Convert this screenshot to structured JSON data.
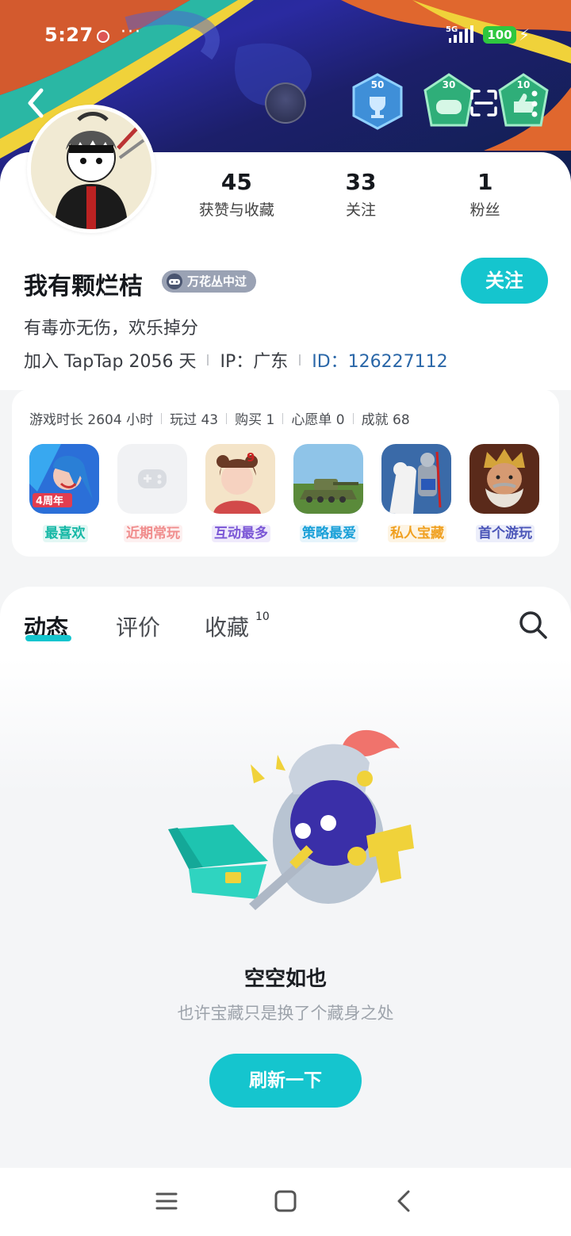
{
  "status_bar": {
    "time": "5:27",
    "more": "···",
    "network": "5G",
    "battery": "100"
  },
  "header": {
    "badges": [
      {
        "number": "50",
        "color": "#3f8fd8"
      },
      {
        "number": "30",
        "color": "#2fae79"
      },
      {
        "number": "10",
        "color": "#2fae79"
      }
    ]
  },
  "profile": {
    "stats": [
      {
        "value": "45",
        "label": "获赞与收藏"
      },
      {
        "value": "33",
        "label": "关注"
      },
      {
        "value": "1",
        "label": "粉丝"
      }
    ],
    "name": "我有颗烂桔",
    "tag": "万花丛中过",
    "follow_label": "关注",
    "bio": "有毒亦无伤，欢乐掉分",
    "joined": "加入 TapTap 2056 天",
    "ip": "IP：广东",
    "id": "ID：126227112"
  },
  "games": {
    "stats": [
      "游戏时长 2604 小时",
      "玩过 43",
      "购买 1",
      "心愿单 0",
      "成就 68"
    ],
    "items": [
      {
        "label": "最喜欢",
        "color": "#16b8a6",
        "bg": "#e3f7f4"
      },
      {
        "label": "近期常玩",
        "color": "#f08d8d",
        "bg": "#fdf0f0"
      },
      {
        "label": "互动最多",
        "color": "#7a56d6",
        "bg": "#efeafb"
      },
      {
        "label": "策略最爱",
        "color": "#1aa0d8",
        "bg": "#e6f4fb"
      },
      {
        "label": "私人宝藏",
        "color": "#f0a020",
        "bg": "#fdf4e3"
      },
      {
        "label": "首个游玩",
        "color": "#4a55b8",
        "bg": "#eceefa"
      }
    ]
  },
  "tabs": {
    "items": [
      "动态",
      "评价",
      "收藏"
    ],
    "collection_count": "10"
  },
  "empty": {
    "title": "空空如也",
    "subtitle": "也许宝藏只是换了个藏身之处",
    "refresh_label": "刷新一下"
  },
  "colors": {
    "accent": "#15c5ce",
    "id_link": "#2a67a8"
  }
}
